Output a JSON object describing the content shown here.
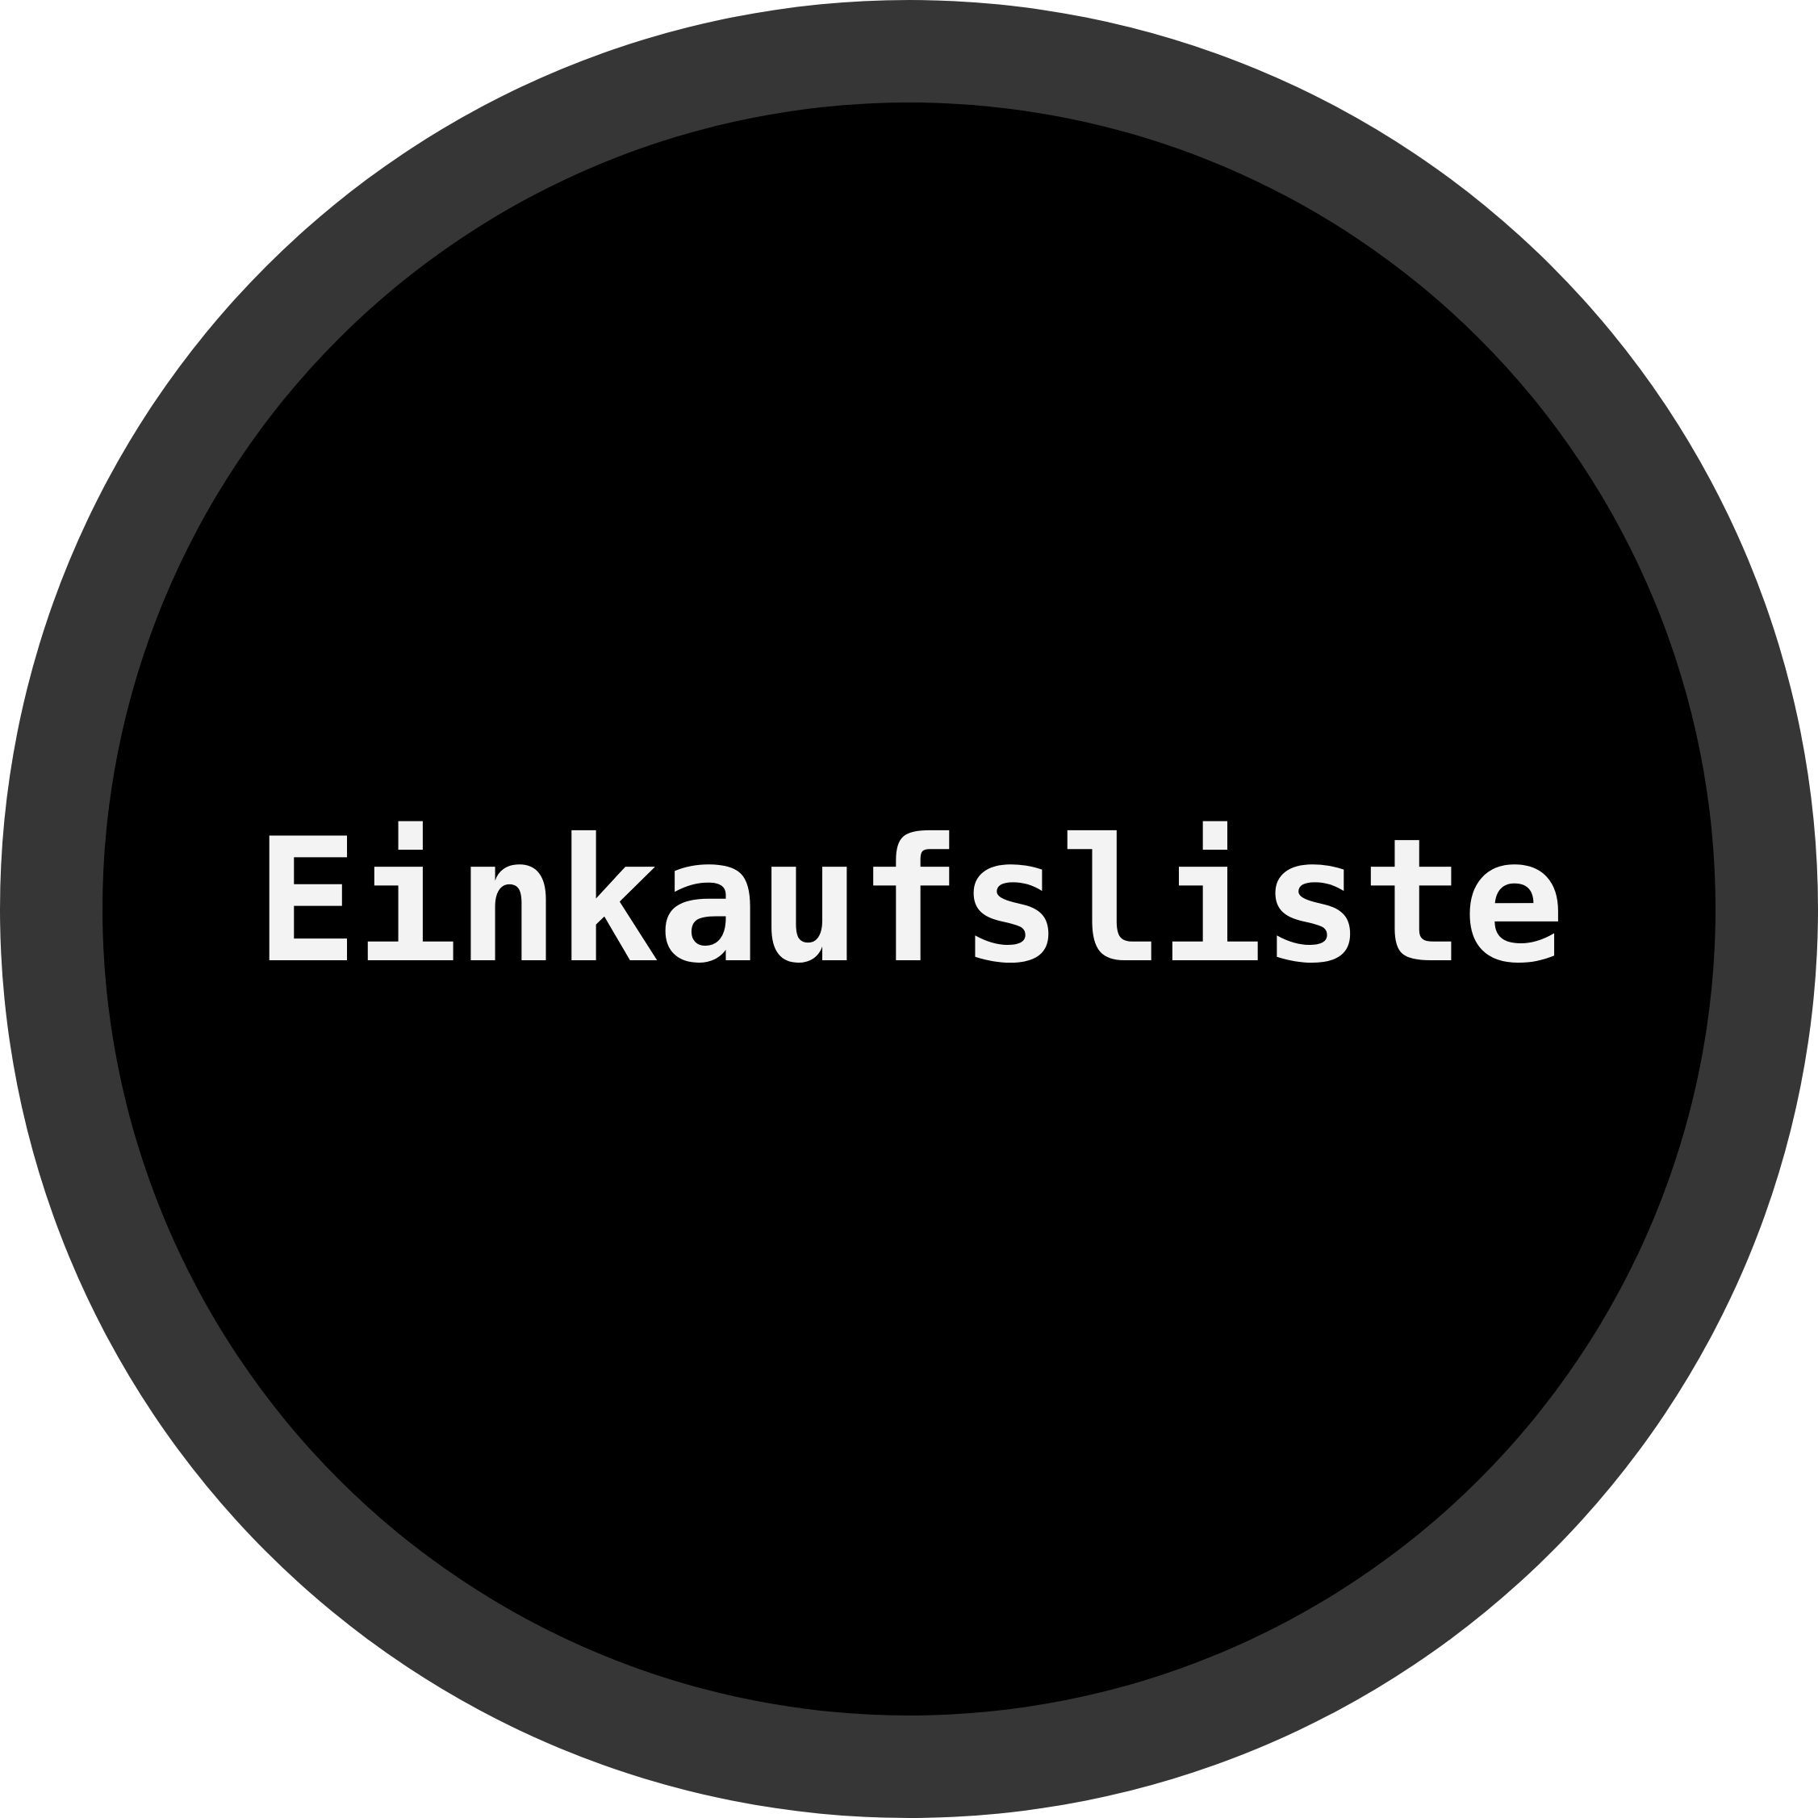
{
  "badge": {
    "title": "Einkaufsliste",
    "colors": {
      "ring": "#363636",
      "disc": "#000000",
      "text": "#f3f3f3"
    }
  }
}
